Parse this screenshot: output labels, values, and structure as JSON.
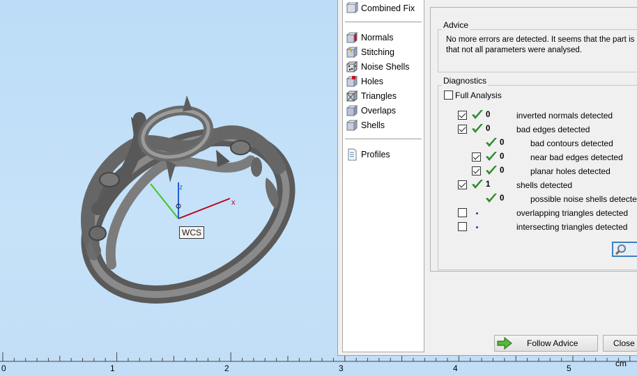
{
  "viewport": {
    "axis_labels": {
      "z": "z",
      "x": "x"
    },
    "wcs_label": "WCS",
    "ruler": {
      "ticks": [
        "0",
        "1",
        "2",
        "3",
        "4",
        "5"
      ],
      "unit": "cm"
    }
  },
  "nav": {
    "items": [
      {
        "label": "Combined Fix",
        "icon": "combined-fix-icon"
      },
      {
        "label": "Normals",
        "icon": "normals-icon"
      },
      {
        "label": "Stitching",
        "icon": "stitching-icon"
      },
      {
        "label": "Noise Shells",
        "icon": "noise-shells-icon"
      },
      {
        "label": "Holes",
        "icon": "holes-icon"
      },
      {
        "label": "Triangles",
        "icon": "triangles-icon"
      },
      {
        "label": "Overlaps",
        "icon": "overlaps-icon"
      },
      {
        "label": "Shells",
        "icon": "shells-icon"
      },
      {
        "label": "Profiles",
        "icon": "profiles-icon"
      }
    ]
  },
  "advice": {
    "title": "Advice",
    "line1": "No more errors are detected. It seems that the part is ok",
    "line2": "that not all parameters were analysed."
  },
  "diagnostics": {
    "title": "Diagnostics",
    "full_analysis_label": "Full Analysis",
    "full_analysis_checked": false,
    "rows": [
      {
        "checked": true,
        "status": "ok",
        "count": "0",
        "label": "inverted normals detected",
        "indent": 0
      },
      {
        "checked": true,
        "status": "ok",
        "count": "0",
        "label": "bad edges detected",
        "indent": 0
      },
      {
        "checked": null,
        "status": "ok",
        "count": "0",
        "label": "bad contours detected",
        "indent": 1
      },
      {
        "checked": true,
        "status": "ok",
        "count": "0",
        "label": "near bad edges detected",
        "indent": 1
      },
      {
        "checked": true,
        "status": "ok",
        "count": "0",
        "label": "planar holes detected",
        "indent": 1
      },
      {
        "checked": true,
        "status": "ok",
        "count": "1",
        "label": "shells detected",
        "indent": 0
      },
      {
        "checked": null,
        "status": "ok",
        "count": "0",
        "label": "possible noise shells detected",
        "indent": 1
      },
      {
        "checked": false,
        "status": "none",
        "count": "",
        "label": "overlapping triangles detected",
        "indent": 0
      },
      {
        "checked": false,
        "status": "none",
        "count": "",
        "label": "intersecting triangles detected",
        "indent": 0
      }
    ]
  },
  "buttons": {
    "follow_advice": "Follow Advice",
    "close": "Close"
  },
  "colors": {
    "tick_green": "#2e8b2e",
    "viewport_bg": "#c5e0f7",
    "axis_x": "#c0001a",
    "axis_y": "#3cc81e",
    "axis_z": "#1f5fd0"
  }
}
